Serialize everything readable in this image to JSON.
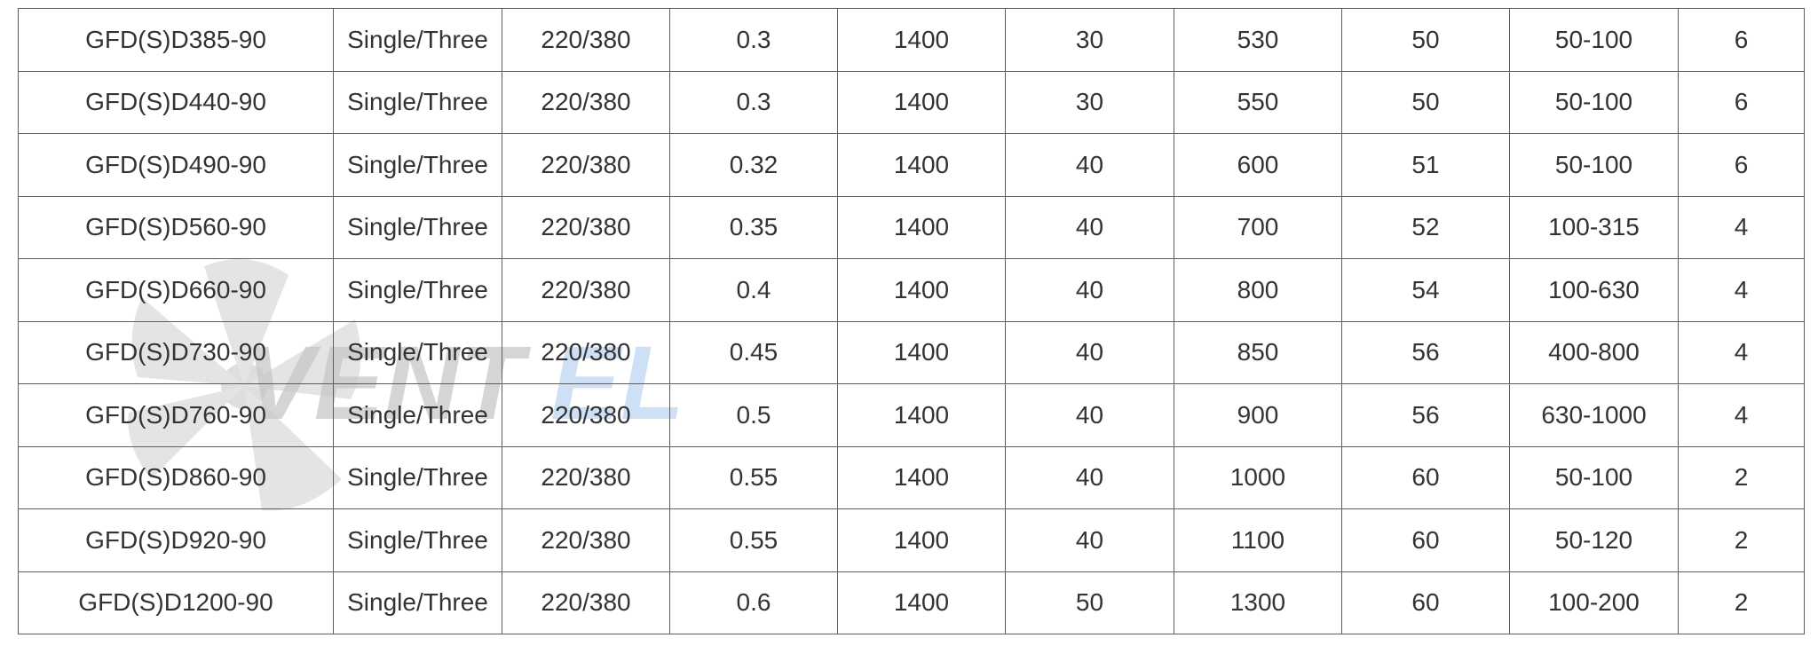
{
  "table": {
    "rows": [
      [
        "GFD(S)D385-90",
        "Single/Three",
        "220/380",
        "0.3",
        "1400",
        "30",
        "530",
        "50",
        "50-100",
        "6"
      ],
      [
        "GFD(S)D440-90",
        "Single/Three",
        "220/380",
        "0.3",
        "1400",
        "30",
        "550",
        "50",
        "50-100",
        "6"
      ],
      [
        "GFD(S)D490-90",
        "Single/Three",
        "220/380",
        "0.32",
        "1400",
        "40",
        "600",
        "51",
        "50-100",
        "6"
      ],
      [
        "GFD(S)D560-90",
        "Single/Three",
        "220/380",
        "0.35",
        "1400",
        "40",
        "700",
        "52",
        "100-315",
        "4"
      ],
      [
        "GFD(S)D660-90",
        "Single/Three",
        "220/380",
        "0.4",
        "1400",
        "40",
        "800",
        "54",
        "100-630",
        "4"
      ],
      [
        "GFD(S)D730-90",
        "Single/Three",
        "220/380",
        "0.45",
        "1400",
        "40",
        "850",
        "56",
        "400-800",
        "4"
      ],
      [
        "GFD(S)D760-90",
        "Single/Three",
        "220/380",
        "0.5",
        "1400",
        "40",
        "900",
        "56",
        "630-1000",
        "4"
      ],
      [
        "GFD(S)D860-90",
        "Single/Three",
        "220/380",
        "0.55",
        "1400",
        "40",
        "1000",
        "60",
        "50-100",
        "2"
      ],
      [
        "GFD(S)D920-90",
        "Single/Three",
        "220/380",
        "0.55",
        "1400",
        "40",
        "1100",
        "60",
        "50-120",
        "2"
      ],
      [
        "GFD(S)D1200-90",
        "Single/Three",
        "220/380",
        "0.6",
        "1400",
        "50",
        "1300",
        "60",
        "100-200",
        "2"
      ]
    ]
  },
  "watermark": {
    "icon": "fan-icon",
    "text_dark": "VENT",
    "text_accent": "EL",
    "dark_color": "#8a8a8a",
    "accent_color": "#4a90e2"
  },
  "colors": {
    "border": "#5e5e5e",
    "text": "#333333"
  }
}
